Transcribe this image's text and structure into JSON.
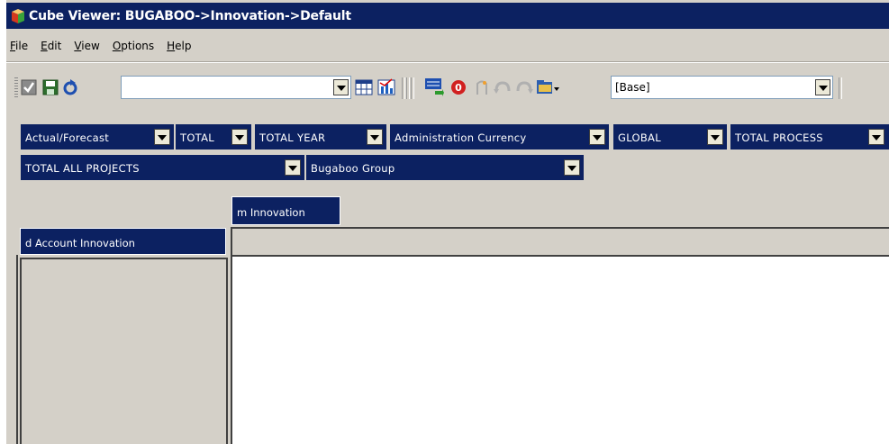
{
  "window": {
    "title": "Cube Viewer: BUGABOO->Innovation->Default"
  },
  "menu": [
    {
      "label": "File",
      "key": "F",
      "rest": "ile"
    },
    {
      "label": "Edit",
      "key": "E",
      "rest": "dit"
    },
    {
      "label": "View",
      "key": "V",
      "rest": "iew"
    },
    {
      "label": "Options",
      "key": "O",
      "rest": "ptions"
    },
    {
      "label": "Help",
      "key": "H",
      "rest": "elp"
    }
  ],
  "toolbar": {
    "view_combo_value": "",
    "subset_combo_value": "[Base]",
    "icons": [
      "check-icon",
      "save-icon",
      "recalculate-icon",
      "spreadsheet-icon",
      "chart-icon",
      "export-icon",
      "zero-suppress-icon",
      "sandbox-icon",
      "undo-icon",
      "redo-icon",
      "folder-dropdown-icon"
    ]
  },
  "dimensions": {
    "row1": [
      "Actual/Forecast",
      "TOTAL",
      "TOTAL YEAR",
      "Administration Currency",
      "GLOBAL",
      "TOTAL PROCESS"
    ],
    "row2": [
      "TOTAL ALL PROJECTS",
      "Bugaboo Group"
    ]
  },
  "grid": {
    "column_dimension": "m Innovation",
    "row_dimension": "d Account Innovation"
  },
  "colors": {
    "header_blue": "#0c2161",
    "window_gray": "#d4d0c8"
  }
}
